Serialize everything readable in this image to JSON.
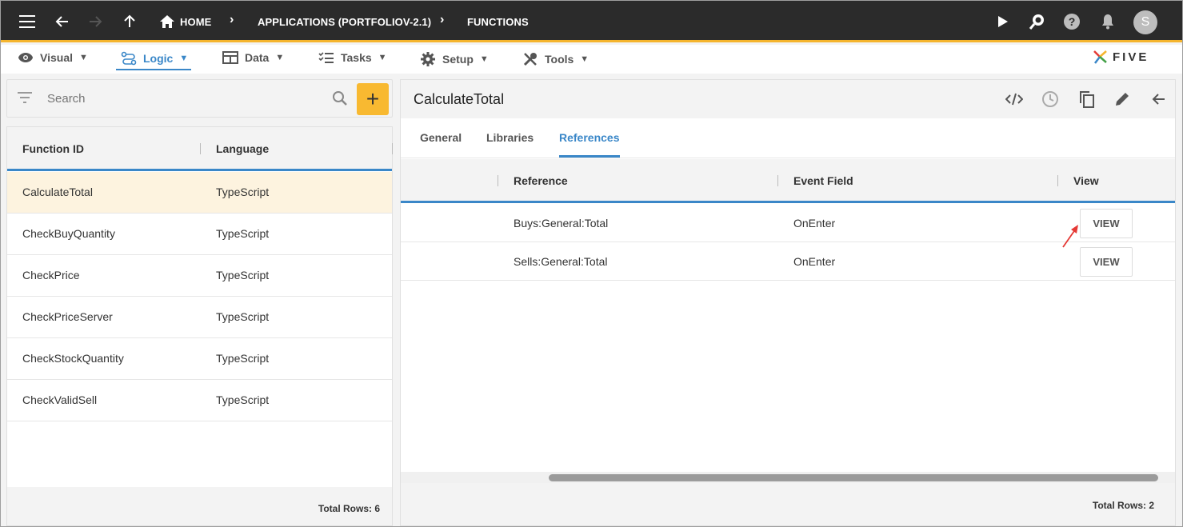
{
  "topbar": {
    "home_label": "HOME",
    "app_label": "APPLICATIONS (PORTFOLIOV-2.1)",
    "functions_label": "FUNCTIONS",
    "avatar_letter": "S",
    "icons": [
      "menu-icon",
      "back-arrow-icon",
      "forward-arrow-icon",
      "up-arrow-icon",
      "home-icon",
      "play-icon",
      "search-zoom-icon",
      "help-icon",
      "bell-icon"
    ]
  },
  "menu": {
    "visual": "Visual",
    "logic": "Logic",
    "data": "Data",
    "tasks": "Tasks",
    "setup": "Setup",
    "tools": "Tools",
    "logo": "FIVE"
  },
  "search": {
    "placeholder": "Search",
    "add_label": "+"
  },
  "functions_table": {
    "headers": [
      "Function ID",
      "Language"
    ],
    "rows": [
      {
        "id": "CalculateTotal",
        "language": "TypeScript"
      },
      {
        "id": "CheckBuyQuantity",
        "language": "TypeScript"
      },
      {
        "id": "CheckPrice",
        "language": "TypeScript"
      },
      {
        "id": "CheckPriceServer",
        "language": "TypeScript"
      },
      {
        "id": "CheckStockQuantity",
        "language": "TypeScript"
      },
      {
        "id": "CheckValidSell",
        "language": "TypeScript"
      }
    ],
    "total": "Total Rows: 6"
  },
  "detail": {
    "title": "CalculateTotal",
    "tabs": [
      "General",
      "Libraries",
      "References"
    ],
    "active_tab": "References",
    "headers": [
      "Reference",
      "Event Field",
      "View"
    ],
    "rows": [
      {
        "reference": "Buys:General:Total",
        "event": "OnEnter",
        "action": "VIEW"
      },
      {
        "reference": "Sells:General:Total",
        "event": "OnEnter",
        "action": "VIEW"
      }
    ],
    "total": "Total Rows: 2"
  },
  "colors": {
    "accent": "#3a87c8",
    "highlight": "#f8b931",
    "topbar": "#2b2b2b",
    "selected_row": "#fdf3df",
    "annotation": "#e53935"
  }
}
